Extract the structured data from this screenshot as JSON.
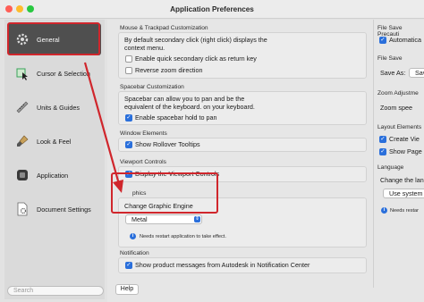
{
  "window": {
    "title": "Application Preferences"
  },
  "sidebar": {
    "items": [
      {
        "label": "General",
        "icon": "gear-icon",
        "active": true
      },
      {
        "label": "Cursor & Selection",
        "icon": "cursor-icon"
      },
      {
        "label": "Units & Guides",
        "icon": "ruler-icon"
      },
      {
        "label": "Look & Feel",
        "icon": "paintbrush-icon"
      },
      {
        "label": "Application",
        "icon": "app-icon"
      },
      {
        "label": "Document Settings",
        "icon": "document-icon"
      }
    ],
    "search_placeholder": "Search"
  },
  "sections": {
    "mouse": {
      "header": "Mouse & Trackpad Customization",
      "description_line1": "By default secondary click (right click) displays the",
      "description_line2": "context menu.",
      "option1": {
        "label": "Enable quick secondary click as return key",
        "checked": false
      },
      "option2": {
        "label": "Reverse zoom direction",
        "checked": false
      }
    },
    "spacebar": {
      "header": "Spacebar Customization",
      "description_line1": "Spacebar can allow you to pan and be the",
      "description_line2": "equivalent of the keyboard. on your keyboard.",
      "option1": {
        "label": "Enable spacebar hold to pan",
        "checked": true
      }
    },
    "window_elements": {
      "header": "Window Elements",
      "option1": {
        "label": "Show Rollover Tooltips",
        "checked": true
      }
    },
    "viewport": {
      "header": "Viewport Controls",
      "option1": {
        "label": "Display the Viewport Controls",
        "checked": true
      }
    },
    "graphics": {
      "header": "phics",
      "label": "Change Graphic Engine",
      "selected": "Metal",
      "note": "Needs restart application to take effect."
    },
    "notification": {
      "header": "Notification",
      "option1": {
        "label": "Show product messages from Autodesk in Notification Center",
        "checked": true
      }
    }
  },
  "right_column": {
    "file_save_prec": {
      "header": "File Save Precauti",
      "option": "Automatica"
    },
    "file_save": {
      "header": "File Save",
      "label": "Save As:",
      "button": "Save As"
    },
    "zoom": {
      "header": "Zoom Adjustme",
      "label": "Zoom spee"
    },
    "layout": {
      "header": "Layout Elements",
      "option1": "Create Vie",
      "option2": "Show Page"
    },
    "language": {
      "header": "Language",
      "label": "Change the lan",
      "selected": "Use system",
      "note": "Needs restar"
    }
  },
  "footer": {
    "help_label": "Help"
  },
  "colors": {
    "accent": "#2a6fdb",
    "annotation": "#d0262c"
  }
}
